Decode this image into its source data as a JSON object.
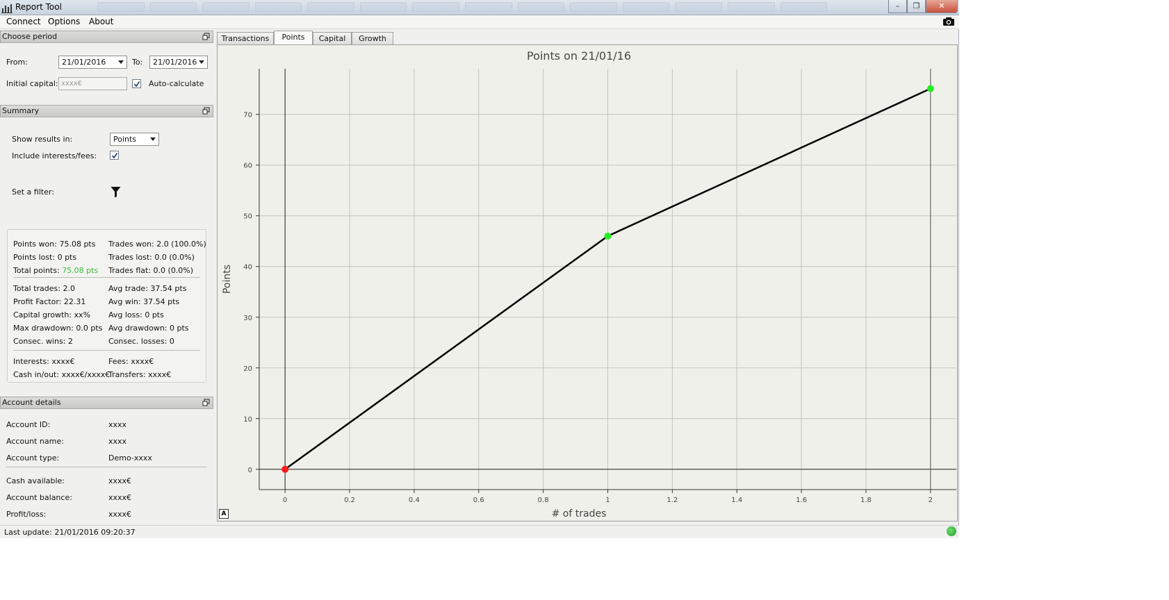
{
  "window": {
    "title": "Report Tool"
  },
  "menu": {
    "items": [
      "Connect",
      "Options",
      "About"
    ]
  },
  "choose_period": {
    "header": "Choose period",
    "from_label": "From:",
    "from_value": "21/01/2016",
    "to_label": "To:",
    "to_value": "21/01/2016",
    "initial_capital_label": "Initial capital:",
    "initial_capital_placeholder": "xxxx€",
    "auto_calculate_label": "Auto-calculate",
    "auto_calculate_checked": true
  },
  "summary": {
    "header": "Summary",
    "show_results_label": "Show results in:",
    "show_results_value": "Points",
    "include_interests_label": "Include interests/fees:",
    "include_interests_checked": true,
    "set_filter_label": "Set a filter:",
    "stats_left": [
      [
        "Points won: ",
        "75.08 pts"
      ],
      [
        "Points lost: ",
        "0 pts"
      ],
      [
        "Total points: ",
        "75.08 pts"
      ],
      [
        "Total trades: ",
        "2.0"
      ],
      [
        "Profit Factor: ",
        "22.31"
      ],
      [
        "Capital growth: ",
        "xx%"
      ],
      [
        "Max drawdown: ",
        "0.0 pts"
      ],
      [
        "Consec. wins: ",
        "2"
      ],
      [
        "Interests: ",
        "xxxx€"
      ],
      [
        "Cash in/out: ",
        "xxxx€/xxxx€"
      ]
    ],
    "stats_right": [
      [
        "Trades won: ",
        "2.0 (100.0%)"
      ],
      [
        "Trades lost: ",
        "0.0 (0.0%)"
      ],
      [
        "Trades flat: ",
        "0.0 (0.0%)"
      ],
      [
        "Avg trade: ",
        "37.54 pts"
      ],
      [
        "Avg win: ",
        "37.54 pts"
      ],
      [
        "Avg loss: ",
        "0 pts"
      ],
      [
        "Avg drawdown: ",
        "0 pts"
      ],
      [
        "Consec. losses: ",
        "0"
      ],
      [
        "Fees: ",
        "xxxx€"
      ],
      [
        "Transfers: ",
        "xxxx€"
      ]
    ],
    "total_points_color": "#3bbd3b"
  },
  "account_details": {
    "header": "Account details",
    "rows": [
      [
        "Account ID:",
        "xxxx"
      ],
      [
        "Account name:",
        "xxxx"
      ],
      [
        "Account type:",
        "Demo-xxxx"
      ],
      [
        "Cash available:",
        "xxxx€"
      ],
      [
        "Account balance:",
        "xxxx€"
      ],
      [
        "Profit/loss:",
        "xxxx€"
      ]
    ]
  },
  "status": {
    "last_update": "Last update: 21/01/2016 09:20:37",
    "connection_color": "#22a832"
  },
  "tabs": [
    "Transactions",
    "Points",
    "Capital",
    "Growth"
  ],
  "active_tab": "Points",
  "chart_data": {
    "type": "line",
    "title": "Points on 21/01/16",
    "xlabel": "# of trades",
    "ylabel": "Points",
    "x": [
      0,
      1,
      2
    ],
    "y": [
      0,
      46,
      75.08
    ],
    "point_colors": [
      "#ff1a1a",
      "#22ee22",
      "#22ee22"
    ],
    "line_color": "#000000",
    "xlim": [
      -0.08,
      2.08
    ],
    "ylim": [
      -4,
      79
    ],
    "xticks": [
      0,
      0.2,
      0.4,
      0.6,
      0.8,
      1,
      1.2,
      1.4,
      1.6,
      1.8,
      2
    ],
    "yticks": [
      0,
      10,
      20,
      30,
      40,
      50,
      60,
      70
    ],
    "grid": true,
    "autoscale_label": "A"
  }
}
